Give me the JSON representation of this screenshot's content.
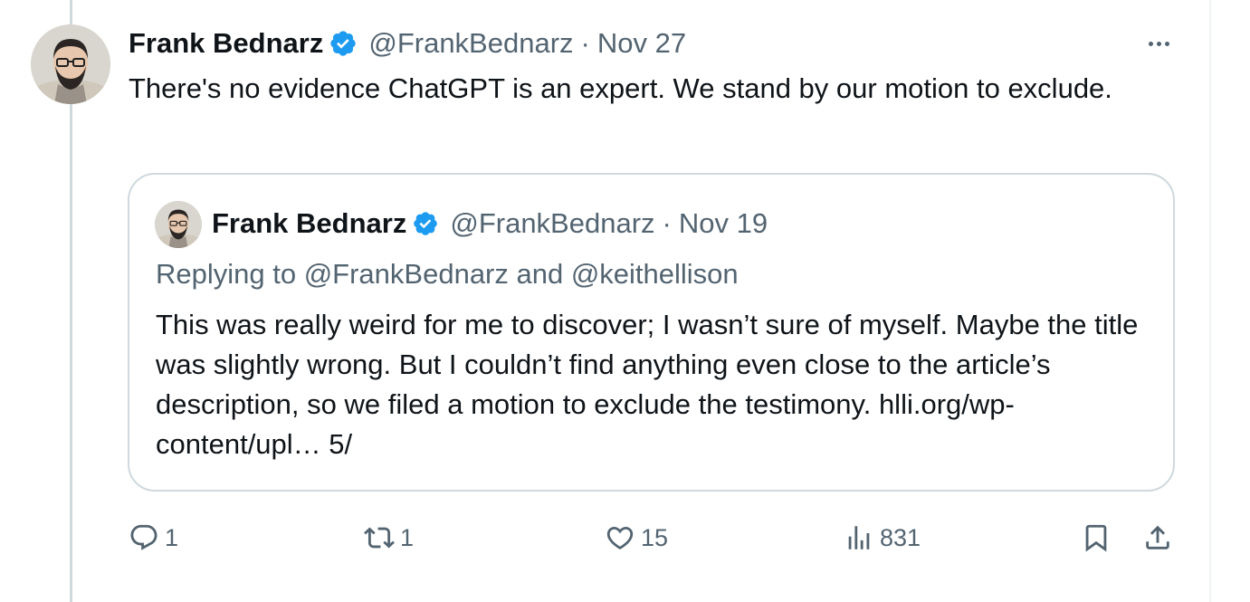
{
  "tweet": {
    "author_name": "Frank Bednarz",
    "handle": "@FrankBednarz",
    "separator": "·",
    "date": "Nov 27",
    "text": "There's no evidence ChatGPT is an expert. We stand by our motion to exclude.",
    "more_icon": "more-horizontal-icon"
  },
  "quote": {
    "author_name": "Frank Bednarz",
    "handle": "@FrankBednarz",
    "separator": "·",
    "date": "Nov 19",
    "replying_to": "Replying to @FrankBednarz and @keithellison",
    "text": "This was really weird for me to discover; I wasn’t sure of myself. Maybe the title was slightly wrong. But I couldn’t find anything even close to the article’s description, so we filed a motion to exclude the testimony. hlli.org/wp-content/upl… 5/"
  },
  "actions": {
    "reply": {
      "icon": "reply-icon",
      "count": "1"
    },
    "retweet": {
      "icon": "retweet-icon",
      "count": "1"
    },
    "like": {
      "icon": "heart-icon",
      "count": "15"
    },
    "views": {
      "icon": "views-icon",
      "count": "831"
    },
    "bookmark": {
      "icon": "bookmark-icon"
    },
    "share": {
      "icon": "share-icon"
    }
  },
  "colors": {
    "text": "#0f1419",
    "secondary": "#536471",
    "verified": "#1d9bf0",
    "border": "#cfd9de"
  }
}
